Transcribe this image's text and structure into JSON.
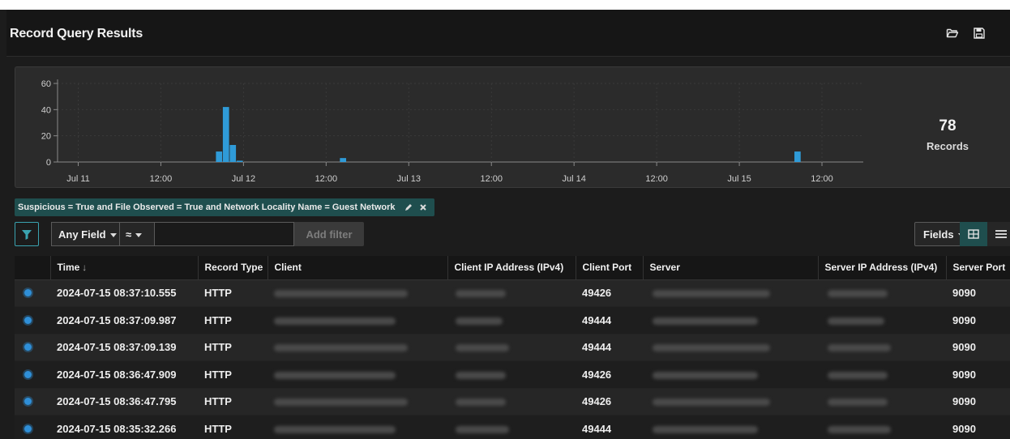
{
  "header": {
    "title": "Record Query Results",
    "icons": [
      "folder-open-icon",
      "save-icon"
    ]
  },
  "chart_data": {
    "type": "bar",
    "x": [
      "Jul 11 20:00",
      "Jul 11 21:00",
      "Jul 11 22:00",
      "Jul 11 23:00",
      "Jul 12 14:00",
      "Jul 15 08:00"
    ],
    "values": [
      8,
      42,
      13,
      1,
      3,
      8
    ],
    "x_ticks": [
      "Jul 11",
      "12:00",
      "Jul 12",
      "12:00",
      "Jul 13",
      "12:00",
      "Jul 14",
      "12:00",
      "Jul 15",
      "12:00"
    ],
    "y_ticks": [
      "0",
      "20",
      "40",
      "60"
    ],
    "ylim": [
      0,
      60
    ],
    "color": "#2f9bd8",
    "grid": true
  },
  "summary": {
    "count": "78",
    "label": "Records"
  },
  "filter_chip": {
    "text": "Suspicious = True and File Observed = True and Network Locality Name = Guest Network"
  },
  "filter_bar": {
    "field_select": "Any Field",
    "operator": "≈",
    "input_value": "",
    "add_filter_label": "Add filter",
    "fields_label": "Fields"
  },
  "table": {
    "columns": [
      "",
      "Time",
      "Record Type",
      "Client",
      "Client IP Address (IPv4)",
      "Client Port",
      "Server",
      "Server IP Address (IPv4)",
      "Server Port"
    ],
    "sort_indicator": "↓",
    "rows": [
      {
        "time": "2024-07-15 08:37:10.555",
        "type": "HTTP",
        "client_port": "49426",
        "server_port": "9090"
      },
      {
        "time": "2024-07-15 08:37:09.987",
        "type": "HTTP",
        "client_port": "49444",
        "server_port": "9090"
      },
      {
        "time": "2024-07-15 08:37:09.139",
        "type": "HTTP",
        "client_port": "49444",
        "server_port": "9090"
      },
      {
        "time": "2024-07-15 08:36:47.909",
        "type": "HTTP",
        "client_port": "49426",
        "server_port": "9090"
      },
      {
        "time": "2024-07-15 08:36:47.795",
        "type": "HTTP",
        "client_port": "49426",
        "server_port": "9090"
      },
      {
        "time": "2024-07-15 08:35:32.266",
        "type": "HTTP",
        "client_port": "49444",
        "server_port": "9090"
      }
    ]
  }
}
